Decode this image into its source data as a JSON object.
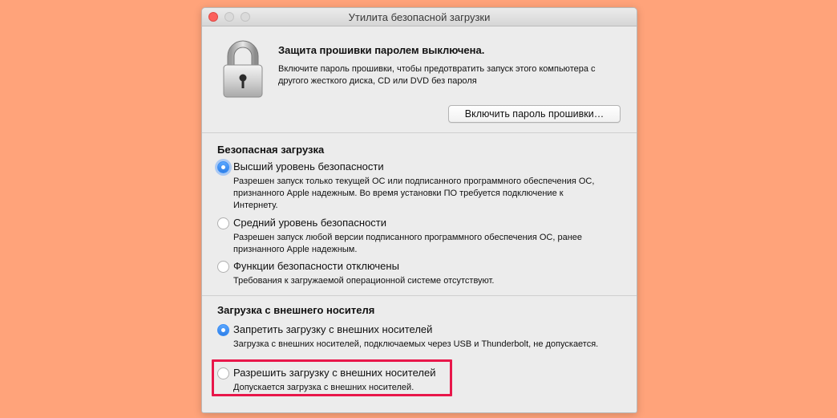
{
  "window": {
    "title": "Утилита безопасной загрузки"
  },
  "firmware": {
    "title": "Защита прошивки паролем выключена.",
    "description": "Включите пароль прошивки, чтобы предотвратить запуск этого компьютера с другого жесткого диска, CD или DVD без пароля",
    "button_label": "Включить пароль прошивки…",
    "icon": "lock-icon"
  },
  "secure_boot": {
    "title": "Безопасная загрузка",
    "options": [
      {
        "label": "Высший уровень безопасности",
        "description": "Разрешен запуск только текущей ОС или подписанного программного обеспечения ОС, признанного Apple надежным. Во время установки ПО требуется подключение к Интернету.",
        "selected": true
      },
      {
        "label": "Средний уровень безопасности",
        "description": "Разрешен запуск любой версии подписанного программного обеспечения ОС, ранее признанного Apple надежным.",
        "selected": false
      },
      {
        "label": "Функции безопасности отключены",
        "description": "Требования к загружаемой операционной системе отсутствуют.",
        "selected": false
      }
    ]
  },
  "external_boot": {
    "title": "Загрузка с внешнего носителя",
    "options": [
      {
        "label": "Запретить загрузку с внешних носителей",
        "description": "Загрузка с внешних носителей, подключаемых через USB и Thunderbolt, не допускается.",
        "selected": true
      },
      {
        "label": "Разрешить загрузку с внешних носителей",
        "description": "Допускается загрузка с внешних носителей.",
        "selected": false
      }
    ]
  },
  "colors": {
    "background": "#ffa37a",
    "accent": "#3a8ef5",
    "highlight": "#e8174a"
  }
}
